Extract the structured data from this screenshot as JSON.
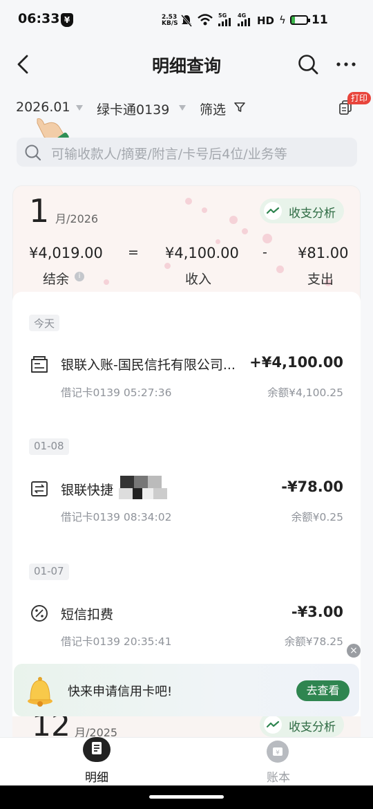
{
  "status_bar": {
    "time": "06:33",
    "net_speed_top": "2.53",
    "net_speed_unit": "KB/S",
    "signal_5g": "5G",
    "signal_4g": "4G",
    "hd_label": "HD",
    "battery_level": "11"
  },
  "header": {
    "title": "明细查询"
  },
  "filters": {
    "month": "2026.01",
    "card": "绿卡通0139",
    "filter_label": "筛选",
    "print_badge": "打印"
  },
  "search": {
    "placeholder": "可输收款人/摘要/附言/卡号后4位/业务等"
  },
  "month_summary": {
    "month_number": "1",
    "month_year": "月/2026",
    "analysis_label": "收支分析",
    "balance_value": "¥4,019.00",
    "equals_sign": "=",
    "income_value": "¥4,100.00",
    "minus_sign": "-",
    "expense_value": "¥81.00",
    "balance_label": "结余",
    "income_label": "收入",
    "expense_label": "支出"
  },
  "transactions": [
    {
      "date_label": "今天",
      "title": "银联入账-国民信托有限公司...",
      "amount": "+¥4,100.00",
      "sub": "借记卡0139 05:27:36",
      "balance": "余额¥4,100.25",
      "icon": "receipt-icon"
    },
    {
      "date_label": "01-08",
      "title": "银联快捷",
      "amount": "-¥78.00",
      "sub": "借记卡0139 08:34:02",
      "balance": "余额¥0.25",
      "icon": "transfer-icon"
    },
    {
      "date_label": "01-07",
      "title": "短信扣费",
      "amount": "-¥3.00",
      "sub": "借记卡0139 20:35:41",
      "balance": "余额¥78.25",
      "icon": "percent-icon"
    }
  ],
  "next_month": {
    "month_number": "12",
    "month_year": "月/2025",
    "analysis_label": "收支分析"
  },
  "promo": {
    "text": "快来申请信用卡吧!",
    "button": "去查看"
  },
  "tabbar": {
    "tabs": [
      {
        "label": "明细",
        "active": true
      },
      {
        "label": "账本",
        "active": false
      }
    ]
  },
  "colors": {
    "accent_green": "#2f8550",
    "analysis_bg": "#e8f3ea",
    "print_badge_red": "#e8453c"
  }
}
